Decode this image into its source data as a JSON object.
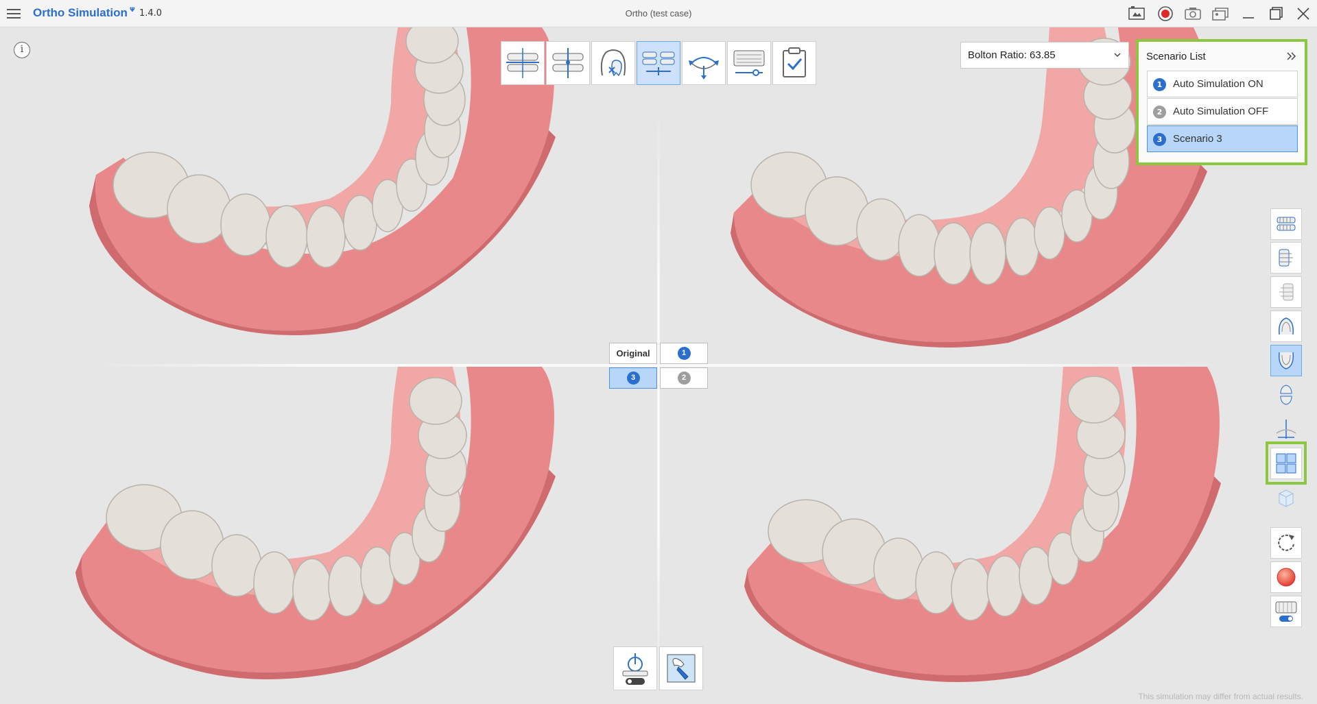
{
  "titlebar": {
    "app_name": "Ortho Simulation",
    "app_badge": "Ψ",
    "version": "1.4.0",
    "case_title": "Ortho (test case)",
    "buttons": [
      "capture-view-icon",
      "record-icon",
      "camera-icon",
      "gallery-icon",
      "minimize-icon",
      "maximize-icon",
      "close-icon"
    ]
  },
  "colors": {
    "accent": "#2b6fce",
    "highlight": "#8dc63f",
    "active_fill": "#b8d6f8",
    "gum": "#e8888a",
    "tooth": "#e2ddd6"
  },
  "info_label": "i",
  "top_toolbar": {
    "tools": [
      {
        "icon": "occlusion-plane-icon",
        "active": false
      },
      {
        "icon": "midline-icon",
        "active": false
      },
      {
        "icon": "tooth-exclude-icon",
        "active": false
      },
      {
        "icon": "arch-compare-icon",
        "active": true
      },
      {
        "icon": "rotate-arch-icon",
        "active": false
      },
      {
        "icon": "ipr-slider-icon",
        "active": false
      },
      {
        "icon": "confirm-clipboard-icon",
        "active": false
      }
    ]
  },
  "bolton": {
    "label": "Bolton Ratio: 63.85"
  },
  "scenario_panel": {
    "title": "Scenario List",
    "items": [
      {
        "num": "1",
        "label": "Auto Simulation ON",
        "num_color": "#2b6fce",
        "active": false
      },
      {
        "num": "2",
        "label": "Auto Simulation OFF",
        "num_color": "#9e9e9e",
        "active": false
      },
      {
        "num": "3",
        "label": "Scenario 3",
        "num_color": "#2b6fce",
        "active": true
      }
    ]
  },
  "compare": {
    "original": "Original",
    "one": "1",
    "three": "3",
    "two": "2"
  },
  "right_toolbar": [
    "view-front-icon",
    "view-right-icon",
    "view-left-icon",
    "view-upper-icon",
    "view-lower-icon",
    "view-split-icon",
    "axis-icon",
    "quad-view-icon",
    "cube-view-icon",
    "reset-view-icon",
    "color-icon",
    "attachment-on-icon"
  ],
  "bottom_tools": [
    "auto-ipr-off-icon",
    "tooth-select-icon"
  ],
  "disclaimer": "This simulation may differ from actual results."
}
